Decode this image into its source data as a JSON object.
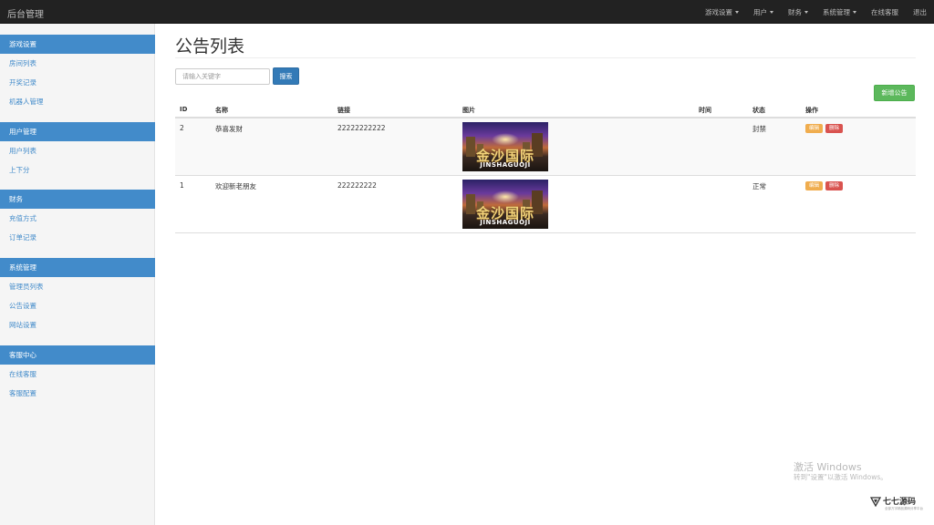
{
  "brand": "后台管理",
  "topnav": [
    {
      "label": "游戏设置",
      "dropdown": true
    },
    {
      "label": "用户",
      "dropdown": true
    },
    {
      "label": "财务",
      "dropdown": true
    },
    {
      "label": "系统管理",
      "dropdown": true
    },
    {
      "label": "在线客服",
      "dropdown": false
    },
    {
      "label": "退出",
      "dropdown": false
    }
  ],
  "sidebar": [
    {
      "title": "游戏设置",
      "items": [
        "房间列表",
        "开奖记录",
        "机器人管理"
      ]
    },
    {
      "title": "用户管理",
      "items": [
        "用户列表",
        "上下分"
      ]
    },
    {
      "title": "财务",
      "items": [
        "充值方式",
        "订单记录"
      ]
    },
    {
      "title": "系统管理",
      "items": [
        "管理员列表",
        "公告设置",
        "网站设置"
      ]
    },
    {
      "title": "客服中心",
      "items": [
        "在线客服",
        "客服配置"
      ]
    }
  ],
  "page": {
    "title": "公告列表",
    "search_placeholder": "请输入关键字",
    "search_label": "搜索",
    "add_label": "新增公告"
  },
  "table": {
    "columns": [
      "ID",
      "名称",
      "链接",
      "图片",
      "时间",
      "状态",
      "操作"
    ],
    "rows": [
      {
        "id": "2",
        "name": "恭喜发财",
        "link": "22222222222",
        "image_cn": "金沙国际",
        "image_en": "JINSHAGUOJI",
        "time": "",
        "status": "封禁",
        "edit": "编辑",
        "delete": "删除"
      },
      {
        "id": "1",
        "name": "欢迎新老朋友",
        "link": "222222222",
        "image_cn": "金沙国际",
        "image_en": "JINSHAGUOJI",
        "time": "",
        "status": "正常",
        "edit": "编辑",
        "delete": "删除"
      }
    ]
  },
  "watermark": {
    "line1": "激活 Windows",
    "line2": "转到\"设置\"以激活 Windows。"
  },
  "corner_logo": {
    "text": "七七源码",
    "sub": "全部万字精品源码分享平台"
  },
  "colors": {
    "topbar": "#222222",
    "sidebar_head": "#428bca",
    "primary": "#337ab7",
    "success": "#5cb85c",
    "warning": "#f0ad4e",
    "danger": "#d9534f"
  }
}
